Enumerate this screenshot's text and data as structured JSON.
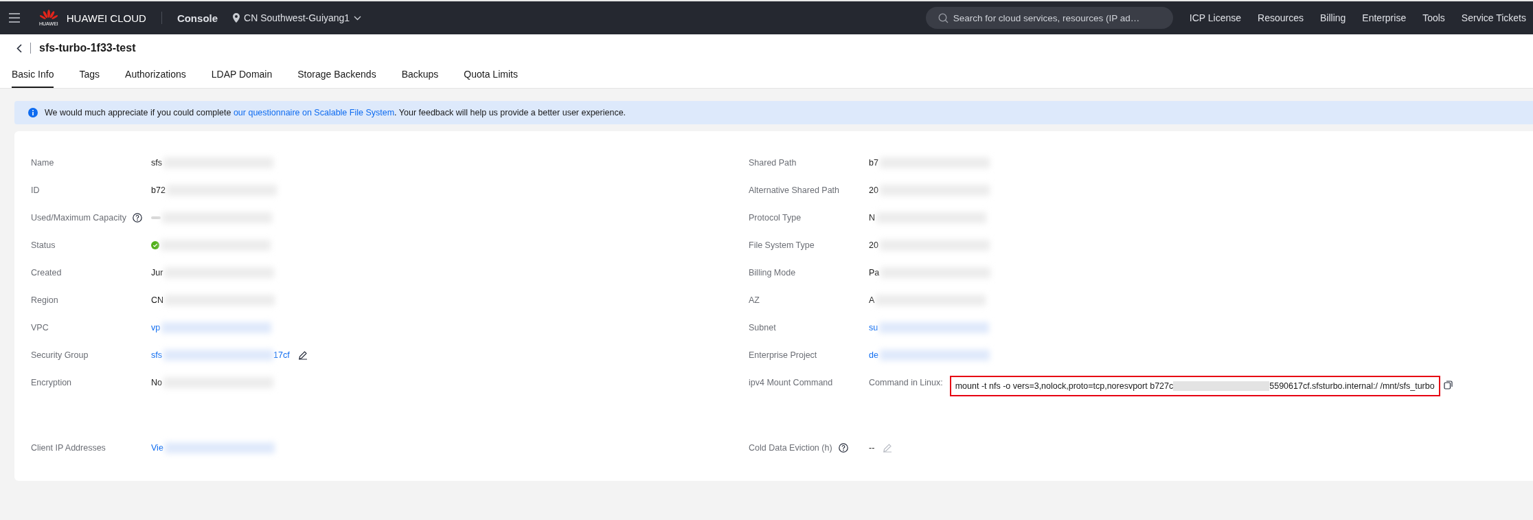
{
  "topbar": {
    "logo_caption": "HUAWEI",
    "brand": "HUAWEI CLOUD",
    "console": "Console",
    "region": "CN Southwest-Guiyang1",
    "search": {
      "placeholder": "Search for cloud services, resources (IP ad…"
    },
    "links": [
      "ICP License",
      "Resources",
      "Billing",
      "Enterprise",
      "Tools",
      "Service Tickets"
    ]
  },
  "page_title": "sfs-turbo-1f33-test",
  "tabs": [
    {
      "label": "Basic Info",
      "selected": true
    },
    {
      "label": "Tags",
      "selected": false
    },
    {
      "label": "Authorizations",
      "selected": false
    },
    {
      "label": "LDAP Domain",
      "selected": false
    },
    {
      "label": "Storage Backends",
      "selected": false
    },
    {
      "label": "Backups",
      "selected": false
    },
    {
      "label": "Quota Limits",
      "selected": false
    }
  ],
  "banner": {
    "before": "We would much appreciate if you could complete ",
    "link": "our questionnaire on Scalable File System",
    "after": ". Your feedback will help us provide a better user experience."
  },
  "rows": [
    {
      "left": {
        "label": "Name",
        "kind": "text",
        "value": "sfs",
        "redacted": true
      },
      "right": {
        "label": "Shared Path",
        "kind": "text",
        "value": "b7",
        "redacted": true
      }
    },
    {
      "left": {
        "label": "ID",
        "kind": "text",
        "value": "b72",
        "redacted": true
      },
      "right": {
        "label": "Alternative Shared Path",
        "kind": "text",
        "value": "20",
        "redacted": true
      }
    },
    {
      "left": {
        "label": "Used/Maximum Capacity",
        "help": true,
        "kind": "capacity",
        "redacted": true
      },
      "right": {
        "label": "Protocol Type",
        "kind": "text",
        "value": "N",
        "redacted": true
      }
    },
    {
      "left": {
        "label": "Status",
        "kind": "status",
        "redacted": true
      },
      "right": {
        "label": "File System Type",
        "kind": "text",
        "value": "20",
        "redacted": true
      }
    },
    {
      "left": {
        "label": "Created",
        "kind": "text",
        "value": "Jur",
        "redacted": true
      },
      "right": {
        "label": "Billing Mode",
        "kind": "text",
        "value": "Pa",
        "redacted": true
      }
    },
    {
      "left": {
        "label": "Region",
        "kind": "text",
        "value": "CN",
        "redacted": true
      },
      "right": {
        "label": "AZ",
        "kind": "text",
        "value": "A",
        "redacted": true
      }
    },
    {
      "left": {
        "label": "VPC",
        "kind": "link",
        "value": "vp",
        "redacted": true
      },
      "right": {
        "label": "Subnet",
        "kind": "link",
        "value": "su",
        "redacted": true
      }
    },
    {
      "left": {
        "label": "Security Group",
        "kind": "link",
        "value": "sfs",
        "value_end": "17cf",
        "redacted": true,
        "editable": true
      },
      "right": {
        "label": "Enterprise Project",
        "kind": "link",
        "value": "de",
        "redacted": true
      }
    },
    {
      "left": {
        "label": "Encryption",
        "kind": "text",
        "value": "No",
        "redacted": true
      },
      "right": {
        "label": "ipv4 Mount Command",
        "kind": "command",
        "sublabel": "Command in Linux:",
        "value": "mount -t nfs -o vers=3,nolock,proto=tcp,noresvport b727c",
        "value_end": "5590617cf.sfsturbo.internal:/ /mnt/sfs_turbo",
        "redacted": true
      }
    },
    {
      "left": {
        "label": "Client IP Addresses",
        "kind": "link",
        "value": "Vie",
        "redacted": true
      },
      "right": {
        "label": "Cold Data Eviction (h)",
        "help": true,
        "kind": "text",
        "value": "--",
        "editable": false
      }
    }
  ]
}
